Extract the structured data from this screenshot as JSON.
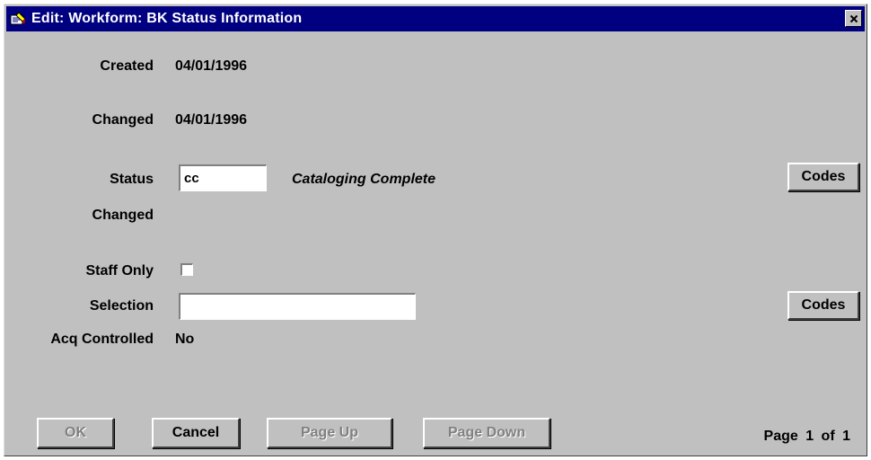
{
  "window": {
    "title": "Edit: Workform: BK Status Information",
    "close_glyph": "✕"
  },
  "fields": {
    "created_label": "Created",
    "created_value": "04/01/1996",
    "changed_label": "Changed",
    "changed_value": "04/01/1996",
    "status_label": "Status",
    "status_value": "cc",
    "status_description": "Cataloging Complete",
    "status_changed_label": "Changed",
    "staff_only_label": "Staff Only",
    "staff_only_checked": false,
    "selection_label": "Selection",
    "selection_value": "",
    "acq_controlled_label": "Acq Controlled",
    "acq_controlled_value": "No"
  },
  "buttons": {
    "status_codes": "Codes",
    "selection_codes": "Codes",
    "ok": "OK",
    "cancel": "Cancel",
    "page_up": "Page Up",
    "page_down": "Page Down"
  },
  "pagination": {
    "text": "Page  1  of  1"
  },
  "icons": {
    "app_icon": "workform-app-icon",
    "close_icon": "close-icon"
  }
}
